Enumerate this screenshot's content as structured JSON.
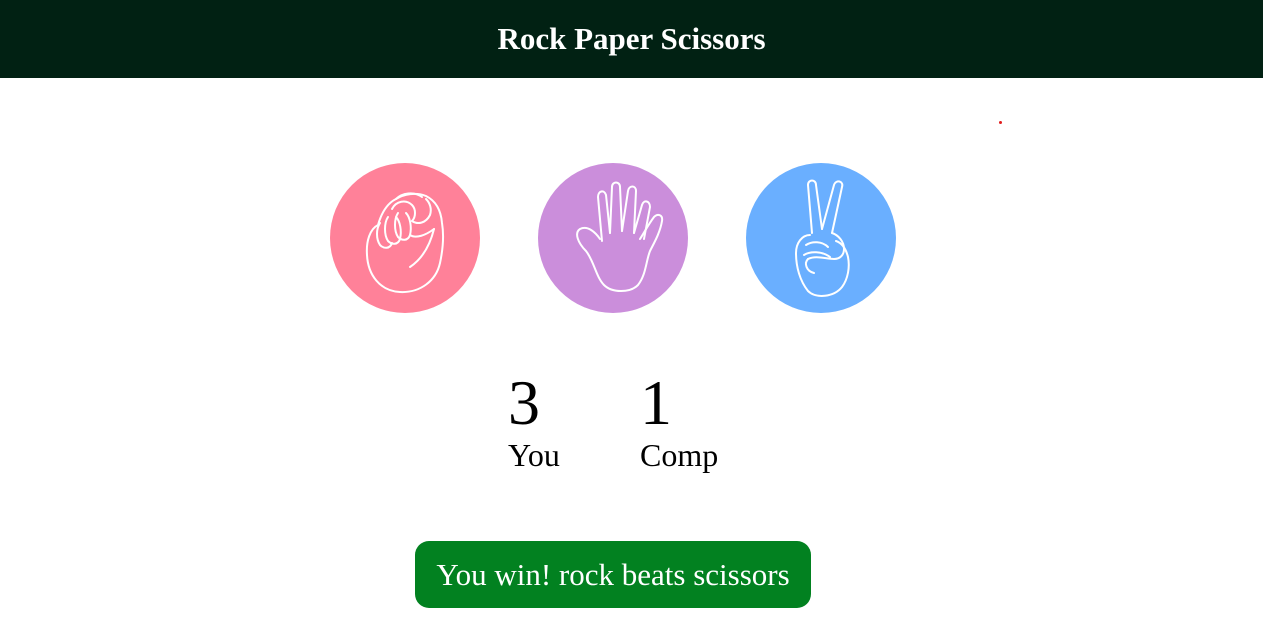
{
  "header": {
    "title": "Rock Paper Scissors"
  },
  "choices": [
    {
      "id": "rock",
      "icon": "fist-icon",
      "color": "#ff8199"
    },
    {
      "id": "paper",
      "icon": "open-hand-icon",
      "color": "#cb8edb"
    },
    {
      "id": "scissors",
      "icon": "peace-sign-hand-icon",
      "color": "#6aafff"
    }
  ],
  "scoreboard": {
    "user": {
      "score": "3",
      "label": "You"
    },
    "computer": {
      "score": "1",
      "label": "Comp"
    }
  },
  "result": {
    "message": "You win! rock beats scissors",
    "color": "#028120"
  },
  "colors": {
    "header_bg": "#012113",
    "accent_dot": "#e11d1d"
  }
}
